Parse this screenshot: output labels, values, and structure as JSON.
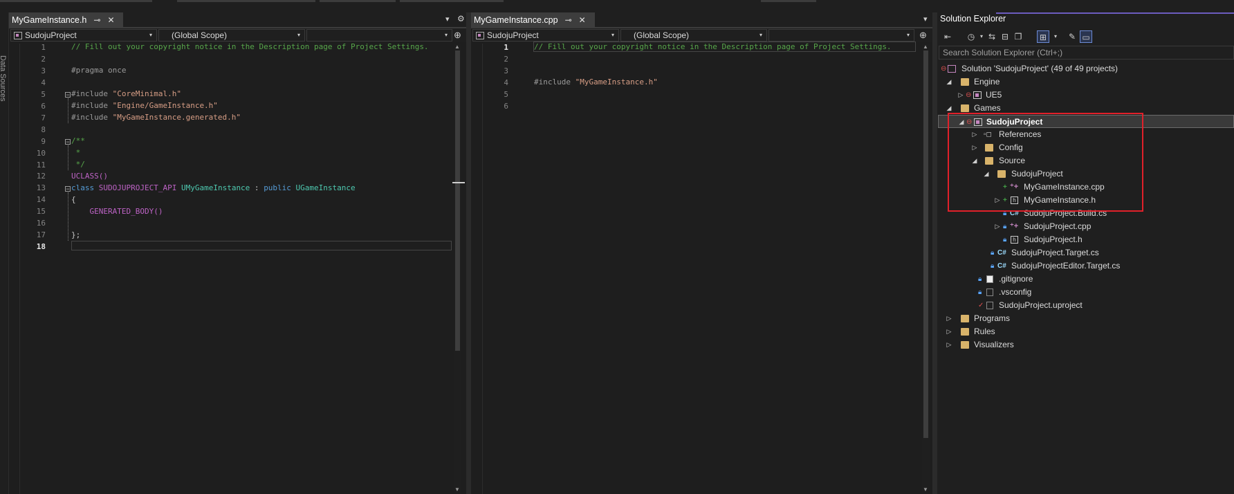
{
  "left_strip_text": "Data Sources",
  "left_editor": {
    "tab_label": "MyGameInstance.h",
    "tab_pin": "⊸",
    "tab_close": "✕",
    "project_combo": "SudojuProject",
    "scope_combo": "(Global Scope)",
    "member_combo": "",
    "gear": "⚙",
    "dropdown": "▾",
    "split": "⊕",
    "line_numbers": [
      "1",
      "2",
      "3",
      "4",
      "5",
      "6",
      "7",
      "8",
      "9",
      "10",
      "11",
      "12",
      "13",
      "14",
      "15",
      "16",
      "17",
      "18"
    ],
    "current_line": "18",
    "lines": {
      "l1": "// Fill out your copyright notice in the Description page of Project Settings.",
      "l3": "#pragma once",
      "l5a": "#include ",
      "l5b": "\"CoreMinimal.h\"",
      "l6a": "#include ",
      "l6b": "\"Engine/GameInstance.h\"",
      "l7a": "#include ",
      "l7b": "\"MyGameInstance.generated.h\"",
      "l9": "/**",
      "l10": " *",
      "l11": " */",
      "l12": "UCLASS()",
      "l13a": "class ",
      "l13b": "SUDOJUPROJECT_API ",
      "l13c": "UMyGameInstance",
      "l13d": " : ",
      "l13e": "public ",
      "l13f": "UGameInstance",
      "l14": "{",
      "l15": "    GENERATED_BODY()",
      "l17": "};"
    }
  },
  "right_editor": {
    "tab_label": "MyGameInstance.cpp",
    "tab_pin": "⊸",
    "tab_close": "✕",
    "project_combo": "SudojuProject",
    "scope_combo": "(Global Scope)",
    "member_combo": "",
    "dropdown": "▾",
    "split": "⊕",
    "line_numbers": [
      "1",
      "2",
      "3",
      "4",
      "5",
      "6"
    ],
    "current_line": "1",
    "lines": {
      "l1": "// Fill out your copyright notice in the Description page of Project Settings.",
      "l4a": "#include ",
      "l4b": "\"MyGameInstance.h\""
    }
  },
  "solution_explorer": {
    "title": "Solution Explorer",
    "search_placeholder": "Search Solution Explorer (Ctrl+;)",
    "tree": [
      {
        "label": "Solution 'SudojuProject'  (49 of 49 projects)"
      },
      {
        "label": "Engine"
      },
      {
        "label": "UE5"
      },
      {
        "label": "Games"
      },
      {
        "label": "SudojuProject"
      },
      {
        "label": "References"
      },
      {
        "label": "Config"
      },
      {
        "label": "Source"
      },
      {
        "label": "SudojuProject"
      },
      {
        "label": "MyGameInstance.cpp"
      },
      {
        "label": "MyGameInstance.h"
      },
      {
        "label": "SudojuProject.Build.cs"
      },
      {
        "label": "SudojuProject.cpp"
      },
      {
        "label": "SudojuProject.h"
      },
      {
        "label": "SudojuProject.Target.cs"
      },
      {
        "label": "SudojuProjectEditor.Target.cs"
      },
      {
        "label": ".gitignore"
      },
      {
        "label": ".vsconfig"
      },
      {
        "label": "SudojuProject.uproject"
      },
      {
        "label": "Programs"
      },
      {
        "label": "Rules"
      },
      {
        "label": "Visualizers"
      }
    ]
  },
  "colors": {
    "highlight_box": "#e1202a",
    "accent": "#6c5cbf"
  }
}
